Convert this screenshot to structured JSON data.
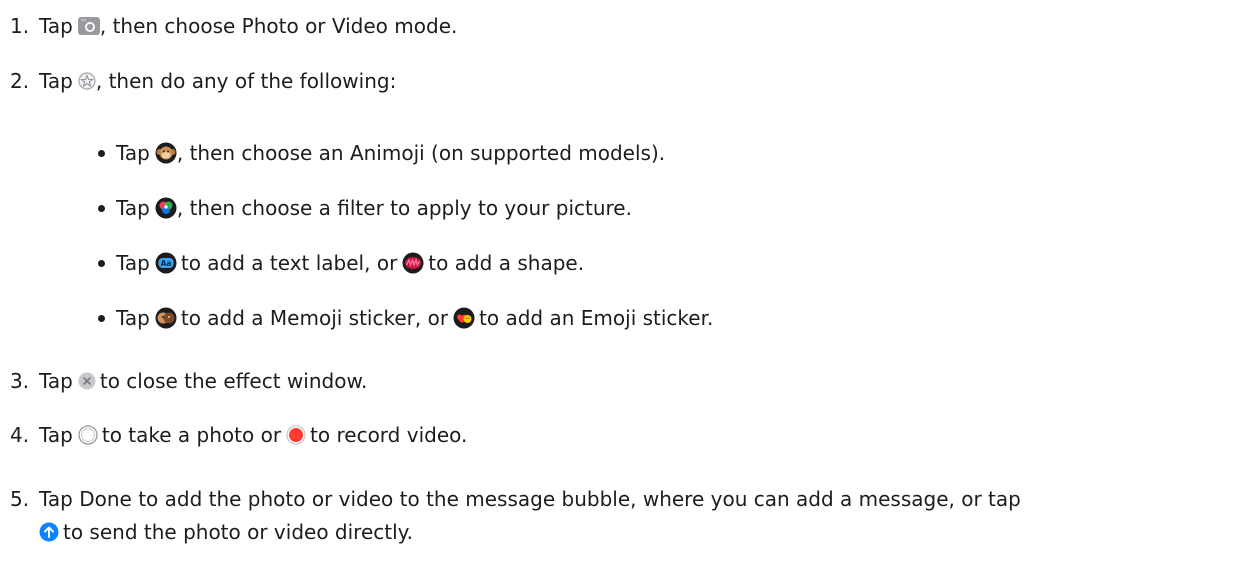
{
  "steps": [
    {
      "num": "1.",
      "pre": "Tap",
      "post": ", then choose Photo or Video mode."
    },
    {
      "num": "2.",
      "pre": "Tap",
      "post": ", then do any of the following:"
    },
    {
      "num": "3.",
      "pre": "Tap",
      "post": "to close the effect window."
    },
    {
      "num": "4.",
      "pre": "Tap",
      "mid": "to take a photo or",
      "post": "to record video."
    },
    {
      "num": "5.",
      "text": "Tap Done to add the photo or video to the message bubble, where you can add a message, or tap",
      "cont": "to send the photo or video directly."
    }
  ],
  "bullets": [
    {
      "pre": "Tap",
      "post": ", then choose an Animoji (on supported models)."
    },
    {
      "pre": "Tap",
      "post": ", then choose a filter to apply to your picture."
    },
    {
      "pre": "Tap",
      "mid": "to add a text label, or",
      "post": "to add a shape."
    },
    {
      "pre": "Tap",
      "mid": "to add a Memoji sticker, or",
      "post": "to add an Emoji sticker."
    }
  ],
  "icons": {
    "camera": "camera-icon",
    "effects": "effects-star-icon",
    "animoji": "animoji-monkey-icon",
    "filters": "filters-icon",
    "text_label": "text-label-icon",
    "shapes": "shapes-icon",
    "memoji": "memoji-sticker-icon",
    "emoji": "emoji-sticker-icon",
    "close": "close-icon",
    "shutter": "shutter-icon",
    "record": "record-icon",
    "send": "send-arrow-icon"
  },
  "colors": {
    "text": "#1d1d1f",
    "record_red": "#ff3b30",
    "send_blue": "#0a84ff"
  }
}
